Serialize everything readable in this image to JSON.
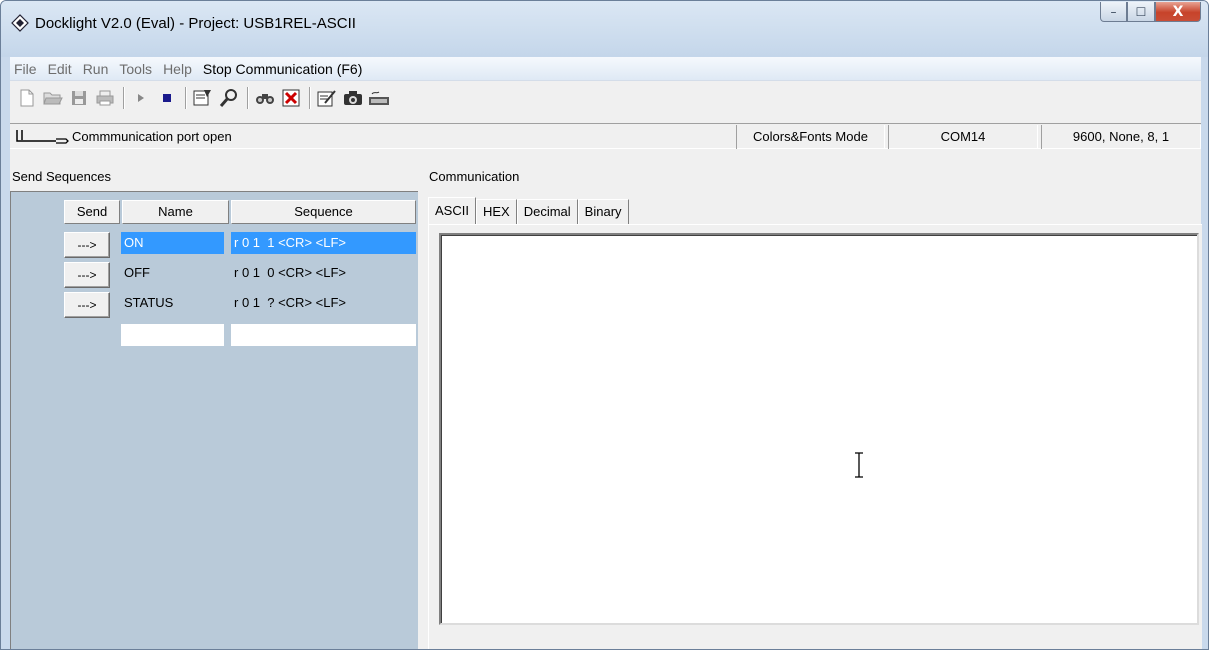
{
  "window": {
    "title": "Docklight V2.0 (Eval) - Project: USB1REL-ASCII",
    "controls": {
      "minimize": "–",
      "maximize": "☐",
      "close": "X"
    }
  },
  "menubar": {
    "items": [
      "File",
      "Edit",
      "Run",
      "Tools",
      "Help"
    ],
    "stop_label": "Stop Communication  (F6)"
  },
  "toolbar": {
    "icons": [
      "new-icon",
      "open-icon",
      "save-icon",
      "print-icon",
      "start-icon",
      "stop-icon",
      "properties-icon",
      "settings-icon",
      "find-icon",
      "clear-icon",
      "edit-icon",
      "snapshot-icon",
      "keyboard-icon"
    ]
  },
  "status": {
    "port_text": "Commmunication port open",
    "mode": "Colors&Fonts Mode",
    "port": "COM14",
    "settings": "9600, None, 8, 1"
  },
  "send_sequences": {
    "label": "Send Sequences",
    "headers": {
      "send": "Send",
      "name": "Name",
      "sequence": "Sequence"
    },
    "button_label": "--->",
    "rows": [
      {
        "name": "ON",
        "sequence": "r 0 1  1 <CR> <LF>"
      },
      {
        "name": "OFF",
        "sequence": "r 0 1  0 <CR> <LF>"
      },
      {
        "name": "STATUS",
        "sequence": "r 0 1  ? <CR> <LF>"
      }
    ]
  },
  "communication": {
    "label": "Communication",
    "tabs": [
      "ASCII",
      "HEX",
      "Decimal",
      "Binary"
    ],
    "active_tab": "ASCII"
  }
}
